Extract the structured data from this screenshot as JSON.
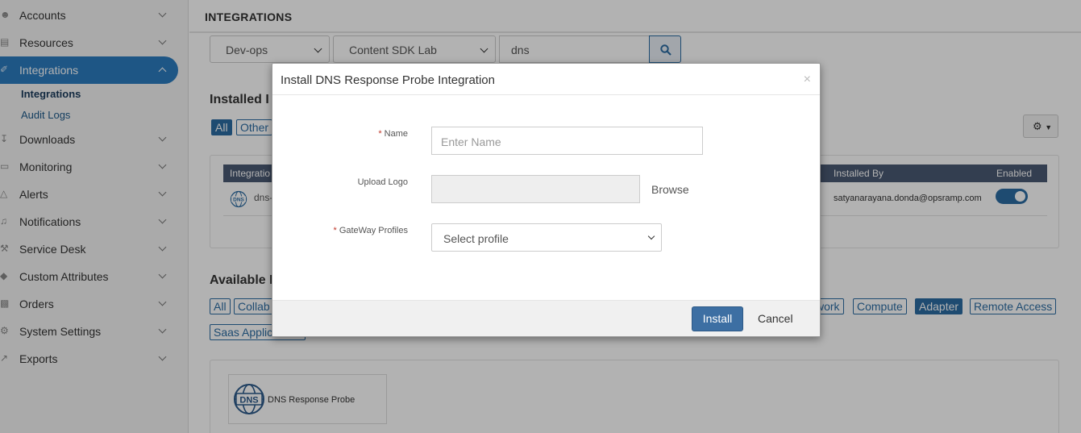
{
  "sidebar": {
    "items": [
      {
        "label": "Accounts",
        "icon": "user-icon"
      },
      {
        "label": "Resources",
        "icon": "server-icon"
      },
      {
        "label": "Integrations",
        "icon": "plug-icon",
        "active": true
      },
      {
        "label": "Downloads",
        "icon": "download-icon"
      },
      {
        "label": "Monitoring",
        "icon": "monitor-icon"
      },
      {
        "label": "Alerts",
        "icon": "warning-icon"
      },
      {
        "label": "Notifications",
        "icon": "bell-icon"
      },
      {
        "label": "Service Desk",
        "icon": "wrench-icon"
      },
      {
        "label": "Custom Attributes",
        "icon": "tag-icon"
      },
      {
        "label": "Orders",
        "icon": "clipboard-icon"
      },
      {
        "label": "System Settings",
        "icon": "gear-icon"
      },
      {
        "label": "Exports",
        "icon": "export-icon"
      }
    ],
    "sub_items": [
      {
        "label": "Integrations",
        "active": true
      },
      {
        "label": "Audit Logs"
      }
    ]
  },
  "header": {
    "title": "INTEGRATIONS"
  },
  "filters": {
    "client": "Dev-ops",
    "lab": "Content SDK Lab",
    "search_value": "dns"
  },
  "installed": {
    "title": "Installed I",
    "chips": [
      "All",
      "Other"
    ],
    "columns": {
      "integration": "Integratio",
      "installed_by": "Installed By",
      "enabled": "Enabled"
    },
    "rows": [
      {
        "name": "dns-",
        "installed_by": "satyanarayana.donda@opsramp.com",
        "enabled": true
      }
    ]
  },
  "available": {
    "title": "Available I",
    "chips_row1": [
      "All",
      "Collab",
      "work",
      "Compute",
      "Adapter",
      "Remote Access"
    ],
    "active_chip": "Adapter",
    "chips_row2": [
      "Saas Applic"
    ],
    "cards": [
      {
        "label": "DNS Response Probe",
        "icon_text": "DNS"
      }
    ]
  },
  "modal": {
    "title": "Install DNS Response Probe Integration",
    "close": "×",
    "name_label": "Name",
    "name_placeholder": "Enter Name",
    "logo_label": "Upload Logo",
    "browse": "Browse",
    "gateway_label": "GateWay Profiles",
    "gateway_value": "Select profile",
    "install": "Install",
    "cancel": "Cancel"
  },
  "colors": {
    "accent": "#2b6ca3",
    "sidebar_active": "#2b7bbf",
    "required": "#c0392b"
  }
}
